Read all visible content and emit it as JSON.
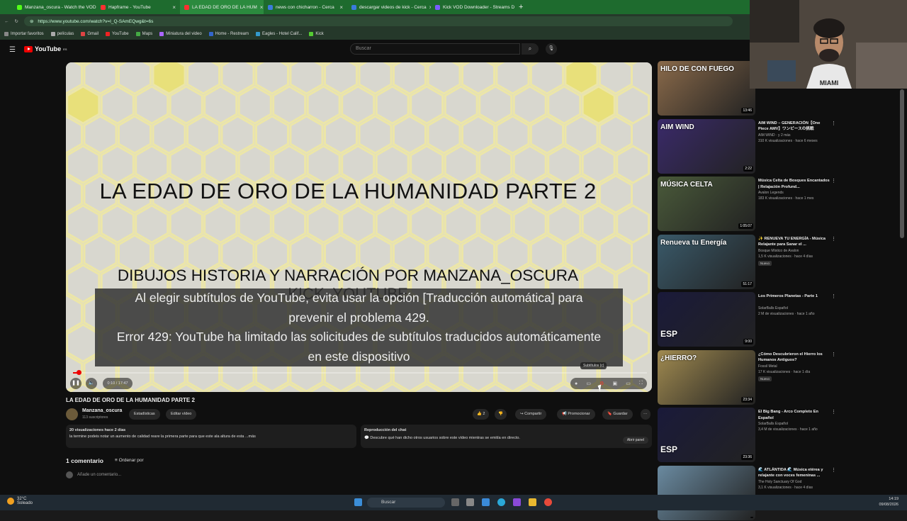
{
  "browser": {
    "tabs": [
      {
        "label": "Manzana_oscura - Watch the VOD",
        "color": "#53fc18",
        "active": false
      },
      {
        "label": "Hapframe - YouTube",
        "color": "#ff3030",
        "active": false
      },
      {
        "label": "LA EDAD DE ORO DE LA HUM",
        "color": "#ff3030",
        "active": true
      },
      {
        "label": "news con chicharron - Cerca",
        "color": "#3b7bdc",
        "active": false
      },
      {
        "label": "descargar videos de kick - Cerca",
        "color": "#3b7bdc",
        "active": false
      },
      {
        "label": "Kick VOD Downloader - Streams D",
        "color": "#7a5cff",
        "active": false
      }
    ],
    "url": "https://www.youtube.com/watch?v=I_Q-SAmEQwg&t=6s",
    "bookmarks": [
      "Importar favoritos",
      "películas",
      "Gmail",
      "YouTube",
      "Maps",
      "Miniatura del video",
      "Home - Restream",
      "Eagles - Hotel Calif...",
      "Kick"
    ]
  },
  "youtube": {
    "logo": "YouTube",
    "logo_region": "ES",
    "search_placeholder": "Buscar"
  },
  "player": {
    "slide_title": "LA EDAD DE ORO DE LA HUMANIDAD PARTE 2",
    "slide_subtitle": "DIBUJOS HISTORIA Y NARRACIÓN POR MANZANA_OSCURA",
    "slide_subtitle2": "KICK, YOUTUBE",
    "subtitle_lines": [
      "Al elegir subtítulos de YouTube, evita usar la opción [Traducción automática] para",
      "prevenir el problema 429.",
      "Error 429: YouTube ha limitado las solicitudes de subtítulos traducidos automáticamente",
      "en este dispositivo"
    ],
    "time": "0:10 / 17:47",
    "progress_fraction": 0.01,
    "tooltip": "Subtítulos (c)"
  },
  "video": {
    "title": "LA EDAD DE ORO DE LA HUMANIDAD PARTE 2",
    "channel": "Manzana_oscura",
    "subscribers": "113 suscriptores",
    "btn_stats": "Estadísticas",
    "btn_edit": "Editar vídeo",
    "likes": "2",
    "btn_share": "Compartir",
    "btn_promote": "Promocionar",
    "btn_save": "Guardar",
    "desc_meta": "20 visualizaciones  hace 2 días",
    "desc_text": "la termine podeis notar un aumento de calidad reare la primera parte para que este ala altura de esta ...más",
    "chat_title": "Reproducción del chat",
    "chat_text": "Descubre qué han dicho otros usuarios sobre este vídeo mientras se emitía en directo.",
    "chat_button": "Abrir panel",
    "comments_count": "1 comentario",
    "sort_label": "Ordenar por",
    "add_comment": "Añade un comentario..."
  },
  "recommendations": [
    {
      "title": "",
      "channel": "",
      "meta": "",
      "duration": "13:46",
      "thumb_text": "HILO DE CON FUEGO",
      "thumb_bg": "#8a6a4a",
      "badge": ""
    },
    {
      "title": "AIM WIND – GENERACIÓN【One Piece AMV】ワンピースの挑戦",
      "channel": "AIM WIND · y 2 más",
      "meta": "310 K visualizaciones · hace 6 meses",
      "duration": "2:22",
      "thumb_text": "AIM WIND",
      "thumb_bg": "#3a2a6a",
      "badge": ""
    },
    {
      "title": "Música Celta de Bosques Encantados | Relajación Profund...",
      "channel": "Avalon Legends",
      "meta": "183 K visualizaciones · hace 1 mes",
      "duration": "1:05:07",
      "thumb_text": "MÚSICA CELTA",
      "thumb_bg": "#4a5a3a",
      "badge": ""
    },
    {
      "title": "✨ RENUEVA TU ENERGÍA - Música Relajante para Sanar el ...",
      "channel": "Bosque Místico de Avalon",
      "meta": "1,5 K visualizaciones · hace 4 días",
      "duration": "51:17",
      "thumb_text": "Renueva tu Energía",
      "thumb_bg": "#3a5a6a",
      "badge": "Nuevo"
    },
    {
      "title": "Los Primeros Planetas - Parte 1",
      "channel": "SolarBalls Español",
      "meta": "2 M de visualizaciones · hace 1 año",
      "duration": "9:00",
      "thumb_text": "ESP",
      "thumb_bg": "#1a1a3a",
      "badge": ""
    },
    {
      "title": "¿Cómo Descubrieron el Hierro los Humanos Antiguos?",
      "channel": "Fossil Metal",
      "meta": "17 K visualizaciones · hace 1 día",
      "duration": "23:34",
      "thumb_text": "¿HIERRO?",
      "thumb_bg": "#a08a50",
      "badge": "Nuevo"
    },
    {
      "title": "El Big Bang - Arco Completo En Español",
      "channel": "SolarBalls Español",
      "meta": "3,4 M de visualizaciones · hace 1 año",
      "duration": "23:36",
      "thumb_text": "ESP",
      "thumb_bg": "#1a1a3a",
      "badge": ""
    },
    {
      "title": "🌊 ATLÁNTIDA 🌊 Música etérea y relajante con voces femeninas ...",
      "channel": "The Holy Sanctuary Of God",
      "meta": "3,1 K visualizaciones · hace 4 días",
      "duration": "",
      "thumb_text": "",
      "thumb_bg": "#6a8aa0",
      "badge": ""
    }
  ],
  "taskbar": {
    "temp": "32°C",
    "weather": "Soleado",
    "search": "Buscar",
    "time": "14:19",
    "date": "09/08/2026"
  },
  "colors": {
    "accent_red": "#ff0000",
    "tab_green": "#2b8a3e",
    "honey_yellow": "#e8e07a"
  }
}
